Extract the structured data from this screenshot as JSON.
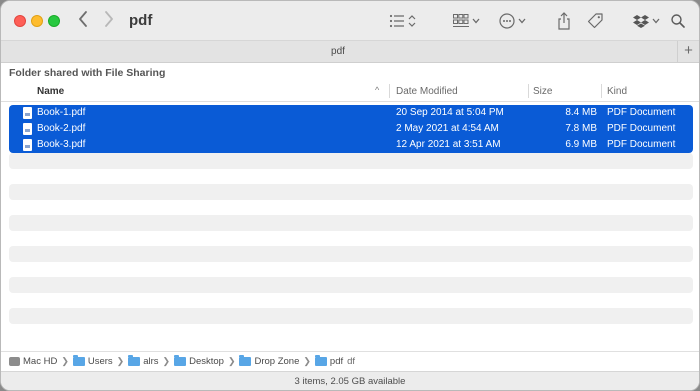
{
  "window": {
    "title": "pdf"
  },
  "tab": {
    "title": "pdf",
    "add_label": "+"
  },
  "section_title": "Folder shared with File Sharing",
  "columns": {
    "name": "Name",
    "date_modified": "Date Modified",
    "size": "Size",
    "kind": "Kind"
  },
  "files": [
    {
      "name": "Book-1.pdf",
      "date": "20 Sep 2014 at 5:04 PM",
      "size": "8.4 MB",
      "kind": "PDF Document"
    },
    {
      "name": "Book-2.pdf",
      "date": "2 May 2021 at 4:54 AM",
      "size": "7.8 MB",
      "kind": "PDF Document"
    },
    {
      "name": "Book-3.pdf",
      "date": "12 Apr 2021 at 3:51 AM",
      "size": "6.9 MB",
      "kind": "PDF Document"
    }
  ],
  "path": [
    {
      "label": "Mac HD",
      "icon": "disk-icon"
    },
    {
      "label": "Users",
      "icon": "folder-icon"
    },
    {
      "label": "alrs",
      "icon": "folder-icon"
    },
    {
      "label": "Desktop",
      "icon": "folder-icon"
    },
    {
      "label": "Drop Zone",
      "icon": "folder-icon"
    },
    {
      "label": "pdf",
      "icon": "folder-icon"
    }
  ],
  "path_extra": "df",
  "status": "3 items, 2.05 GB available",
  "colors": {
    "selection": "#0a5bd6",
    "close": "#fe5f57",
    "minimize": "#febc2e",
    "zoom": "#28c840",
    "folder": "#58a6e6"
  }
}
